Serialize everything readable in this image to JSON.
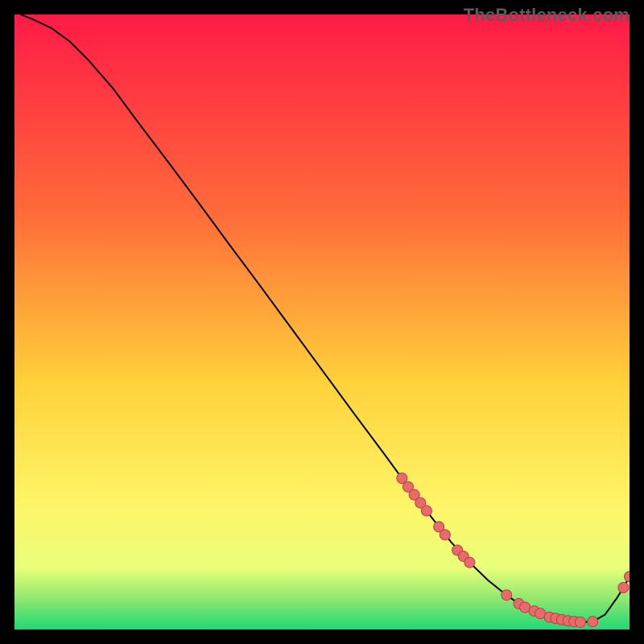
{
  "watermark": "TheBottleneck.com",
  "colors": {
    "background_black": "#000000",
    "gradient_top": "#ff1a47",
    "gradient_upper_mid": "#ff6a3a",
    "gradient_mid": "#ffd23a",
    "gradient_lower_mid": "#fff568",
    "gradient_low": "#e8ff7a",
    "gradient_green_upper": "#8fe86f",
    "gradient_green_lower": "#1fd877",
    "curve": "#000000",
    "marker_fill": "#e96a6a",
    "marker_stroke": "#b04343"
  },
  "chart_data": {
    "type": "line",
    "title": "",
    "xlabel": "",
    "ylabel": "",
    "xlim": [
      0,
      100
    ],
    "ylim": [
      0,
      100
    ],
    "legend_position": "none",
    "grid": false,
    "series": [
      {
        "name": "bottleneck-curve",
        "x": [
          1,
          3,
          6,
          9,
          12,
          16,
          20,
          25,
          30,
          35,
          40,
          45,
          50,
          55,
          60,
          63,
          66,
          68,
          71,
          74,
          77,
          80,
          82,
          84,
          86,
          88,
          90,
          92,
          94,
          96,
          98,
          99,
          100
        ],
        "y": [
          100,
          99.2,
          97.8,
          95.6,
          92.6,
          88,
          82.6,
          76,
          69.3,
          62.5,
          55.8,
          49,
          42.2,
          35.4,
          28.7,
          24.6,
          20.6,
          18,
          14.2,
          10.9,
          8,
          5.6,
          4.2,
          3.2,
          2.4,
          1.8,
          1.4,
          1.2,
          1.3,
          2.4,
          5.2,
          6.8,
          8.6
        ]
      }
    ],
    "scatter_points": {
      "name": "marked-samples",
      "points": [
        {
          "x": 63,
          "y": 24.6
        },
        {
          "x": 64,
          "y": 23.2
        },
        {
          "x": 65,
          "y": 21.9
        },
        {
          "x": 66,
          "y": 20.6
        },
        {
          "x": 67,
          "y": 19.3
        },
        {
          "x": 69,
          "y": 16.7
        },
        {
          "x": 70,
          "y": 15.4
        },
        {
          "x": 72,
          "y": 12.9
        },
        {
          "x": 73,
          "y": 11.9
        },
        {
          "x": 74,
          "y": 10.9
        },
        {
          "x": 80,
          "y": 5.6
        },
        {
          "x": 82,
          "y": 4.2
        },
        {
          "x": 83,
          "y": 3.6
        },
        {
          "x": 84.5,
          "y": 3.0
        },
        {
          "x": 85.5,
          "y": 2.6
        },
        {
          "x": 87,
          "y": 2.0
        },
        {
          "x": 88,
          "y": 1.8
        },
        {
          "x": 89,
          "y": 1.6
        },
        {
          "x": 90,
          "y": 1.4
        },
        {
          "x": 91,
          "y": 1.3
        },
        {
          "x": 92,
          "y": 1.2
        },
        {
          "x": 94,
          "y": 1.3
        },
        {
          "x": 99,
          "y": 6.8
        },
        {
          "x": 100,
          "y": 8.6
        }
      ]
    }
  }
}
